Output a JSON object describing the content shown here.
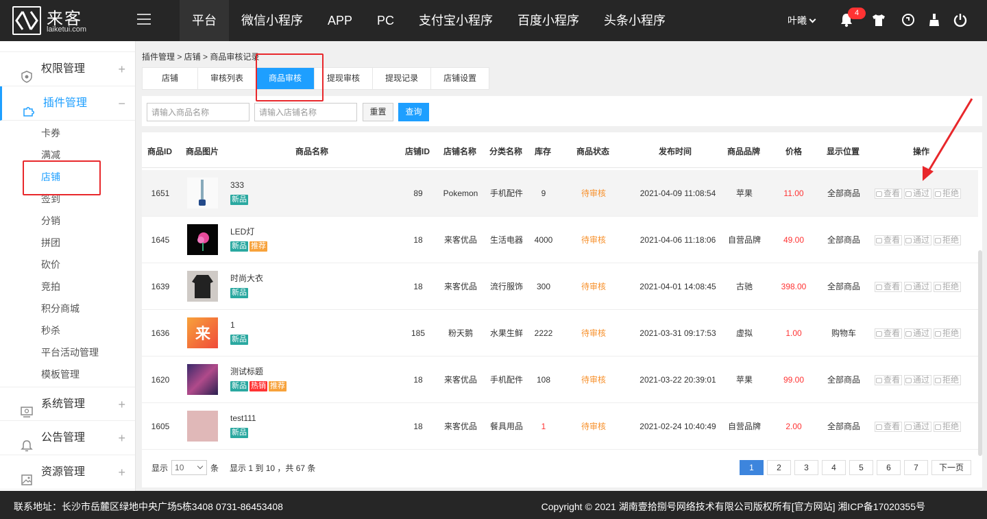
{
  "brand": {
    "name": "来客",
    "sub": "laiketui.com"
  },
  "top_nav": [
    "平台",
    "微信小程序",
    "APP",
    "PC",
    "支付宝小程序",
    "百度小程序",
    "头条小程序"
  ],
  "user": {
    "name": "叶曦",
    "notifications": "4"
  },
  "sidebar": {
    "groups_top": [
      {
        "label": "权限管理",
        "sign": "+"
      },
      {
        "label": "插件管理",
        "sign": "−"
      }
    ],
    "sub_items": [
      "卡券",
      "满减",
      "店铺",
      "签到",
      "分销",
      "拼团",
      "砍价",
      "竞拍",
      "积分商城",
      "秒杀",
      "平台活动管理",
      "模板管理"
    ],
    "groups_bottom": [
      {
        "label": "系统管理",
        "sign": "+"
      },
      {
        "label": "公告管理",
        "sign": "+"
      },
      {
        "label": "资源管理",
        "sign": "+"
      }
    ]
  },
  "breadcrumb": "插件管理 > 店铺 > 商品审核记录",
  "tabs": [
    "店铺",
    "审核列表",
    "商品审核",
    "提现审核",
    "提现记录",
    "店铺设置"
  ],
  "filters": {
    "product_placeholder": "请输入商品名称",
    "store_placeholder": "请输入店铺名称",
    "reset": "重置",
    "query": "查询"
  },
  "table": {
    "headers": [
      "商品ID",
      "商品图片",
      "商品名称",
      "店铺ID",
      "店铺名称",
      "分类名称",
      "库存",
      "商品状态",
      "发布时间",
      "商品品牌",
      "价格",
      "显示位置",
      "操作"
    ],
    "rows": [
      {
        "id": "1651",
        "name": "333",
        "tags": [
          "新品"
        ],
        "store_id": "89",
        "store": "Pokemon",
        "category": "手机配件",
        "stock": "9",
        "status": "待审核",
        "time": "2021-04-09 11:08:54",
        "brand": "苹果",
        "price": "11.00",
        "position": "全部商品"
      },
      {
        "id": "1645",
        "name": "LED灯",
        "tags": [
          "新品",
          "推荐"
        ],
        "store_id": "18",
        "store": "来客优品",
        "category": "生活电器",
        "stock": "4000",
        "status": "待审核",
        "time": "2021-04-06 11:18:06",
        "brand": "自营品牌",
        "price": "49.00",
        "position": "全部商品"
      },
      {
        "id": "1639",
        "name": "时尚大衣",
        "tags": [
          "新品"
        ],
        "store_id": "18",
        "store": "来客优品",
        "category": "流行服饰",
        "stock": "300",
        "status": "待审核",
        "time": "2021-04-01 14:08:45",
        "brand": "古驰",
        "price": "398.00",
        "position": "全部商品"
      },
      {
        "id": "1636",
        "name": "1",
        "tags": [
          "新品"
        ],
        "store_id": "185",
        "store": "粉天鹅",
        "category": "水果生鲜",
        "stock": "2222",
        "status": "待审核",
        "time": "2021-03-31 09:17:53",
        "brand": "虚拟",
        "price": "1.00",
        "position": "购物车"
      },
      {
        "id": "1620",
        "name": "测试标题",
        "tags": [
          "新品",
          "热销",
          "推荐"
        ],
        "store_id": "18",
        "store": "来客优品",
        "category": "手机配件",
        "stock": "108",
        "status": "待审核",
        "time": "2021-03-22 20:39:01",
        "brand": "苹果",
        "price": "99.00",
        "position": "全部商品"
      },
      {
        "id": "1605",
        "name": "test111",
        "tags": [
          "新品"
        ],
        "store_id": "18",
        "store": "来客优品",
        "category": "餐具用品",
        "stock": "1",
        "status": "待审核",
        "time": "2021-02-24 10:40:49",
        "brand": "自营品牌",
        "price": "2.00",
        "position": "全部商品"
      }
    ],
    "actions": [
      "查看",
      "通过",
      "拒绝"
    ]
  },
  "pagination": {
    "show": "显示",
    "page_size": "10",
    "unit": "条",
    "summary": "显示 1 到 10 ，共 67 条",
    "pages": [
      "1",
      "2",
      "3",
      "4",
      "5",
      "6",
      "7"
    ],
    "next": "下一页"
  },
  "footer": {
    "address": "联系地址：长沙市岳麓区绿地中央广场5栋3408 0731-86453408",
    "copyright": "Copyright © 2021 湖南壹拾捌号网络技术有限公司版权所有[官方网站]   湘ICP备17020355号"
  },
  "colors": {
    "accent": "#1e9fff",
    "pending": "#f7902b",
    "price": "#ff3333",
    "annotation": "#e8272b"
  }
}
